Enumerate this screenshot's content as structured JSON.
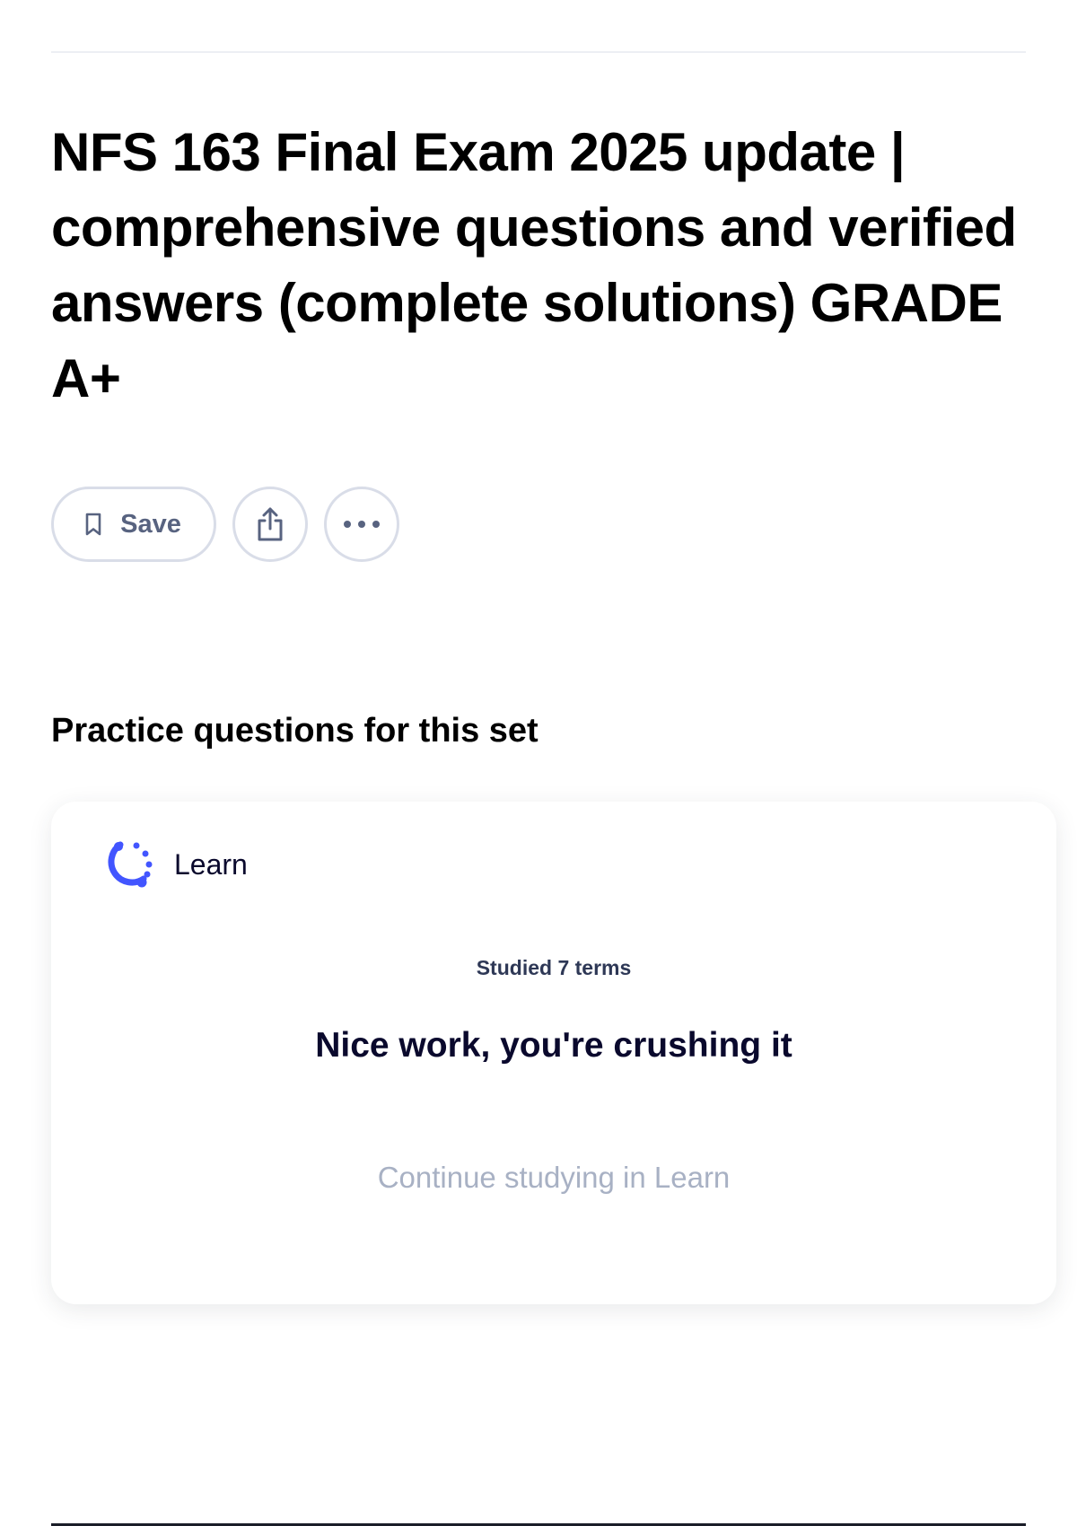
{
  "header": {
    "title": "NFS 163 Final Exam 2025 update | comprehensive questions and verified answers (complete solutions) GRADE A+"
  },
  "actions": {
    "save_label": "Save",
    "save_icon": "bookmark-icon",
    "share_icon": "share-icon",
    "more_icon": "more-horizontal-icon"
  },
  "practice": {
    "heading": "Practice questions for this set",
    "card": {
      "mode_icon": "learn-progress-icon",
      "mode_label": "Learn",
      "studied_text": "Studied 7 terms",
      "message": "Nice work, you're crushing it",
      "continue_label": "Continue studying in Learn"
    }
  },
  "colors": {
    "accent": "#4255ff",
    "muted_text": "#a8b1c4",
    "border": "#d9dde8"
  }
}
